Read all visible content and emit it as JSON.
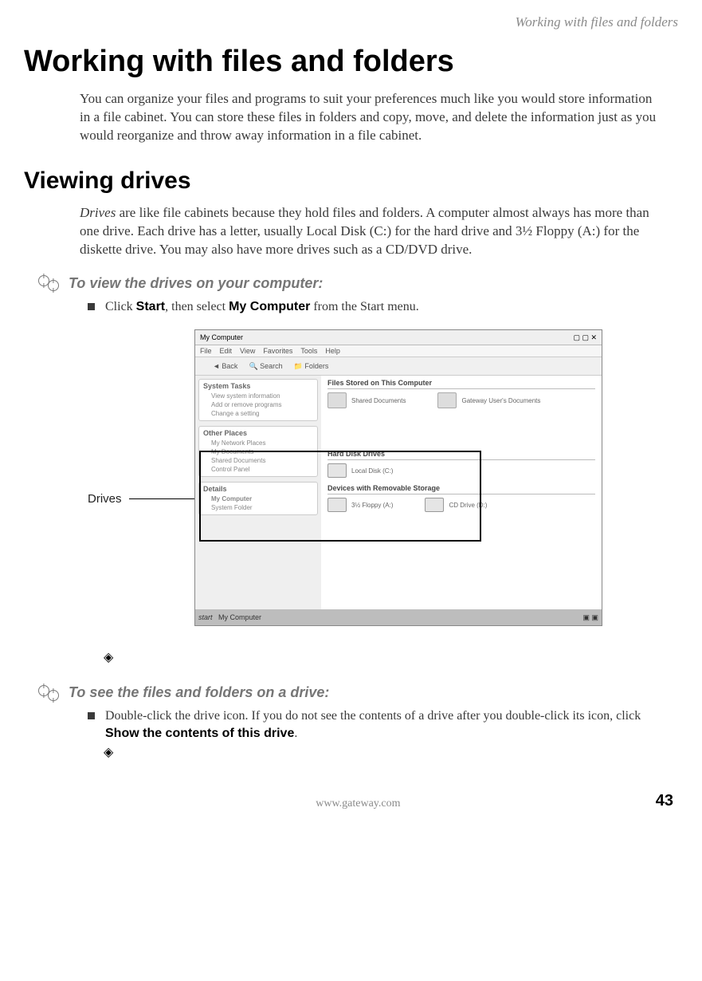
{
  "running_header": "Working with files and folders",
  "title": "Working with files and folders",
  "intro": "You can organize your files and programs to suit your preferences much like you would store information in a file cabinet. You can store these files in folders and copy, move, and delete the information just as you would reorganize and throw away information in a file cabinet.",
  "section2_title": "Viewing drives",
  "drives_para_prefix": "Drives",
  "drives_para_rest": " are like file cabinets because they hold files and folders. A computer almost always has more than one drive. Each drive has a letter, usually Local Disk (C:) for the hard drive and 3½ Floppy (A:) for the diskette drive. You may also have more drives such as a CD/DVD drive.",
  "task1_title": "To view the drives on your computer:",
  "task1_bullet_pre": "Click ",
  "task1_bullet_bold1": "Start",
  "task1_bullet_mid": ", then select ",
  "task1_bullet_bold2": "My Computer",
  "task1_bullet_end": " from the Start menu.",
  "callout_label": "Drives",
  "task2_title": "To see the files and folders on a drive:",
  "task2_bullet": "Double-click the drive icon. If you do not see the contents of a drive after you double-click its icon, click ",
  "task2_bold": "Show the contents of this drive",
  "task2_end": ".",
  "footer_url": "www.gateway.com",
  "page_number": "43",
  "win": {
    "title": "My Computer",
    "menu": [
      "File",
      "Edit",
      "View",
      "Favorites",
      "Tools",
      "Help"
    ],
    "toolbar": [
      "Back",
      "",
      "Search",
      "Folders"
    ],
    "side": {
      "panel1_hdr": "System Tasks",
      "panel1_links": [
        "View system information",
        "Add or remove programs",
        "Change a setting"
      ],
      "panel2_hdr": "Other Places",
      "panel2_links": [
        "My Network Places",
        "My Documents",
        "Shared Documents",
        "Control Panel"
      ],
      "panel3_hdr": "Details",
      "panel3_links": [
        "My Computer",
        "System Folder"
      ]
    },
    "main": {
      "group1": "Files Stored on This Computer",
      "folder1": "Shared Documents",
      "folder2": "Gateway User's Documents",
      "group2": "Hard Disk Drives",
      "drive1": "Local Disk (C:)",
      "group3": "Devices with Removable Storage",
      "drive2": "3½ Floppy (A:)",
      "drive3": "CD Drive (D:)"
    },
    "taskbar_start": "start",
    "taskbar_app": "My Computer"
  }
}
